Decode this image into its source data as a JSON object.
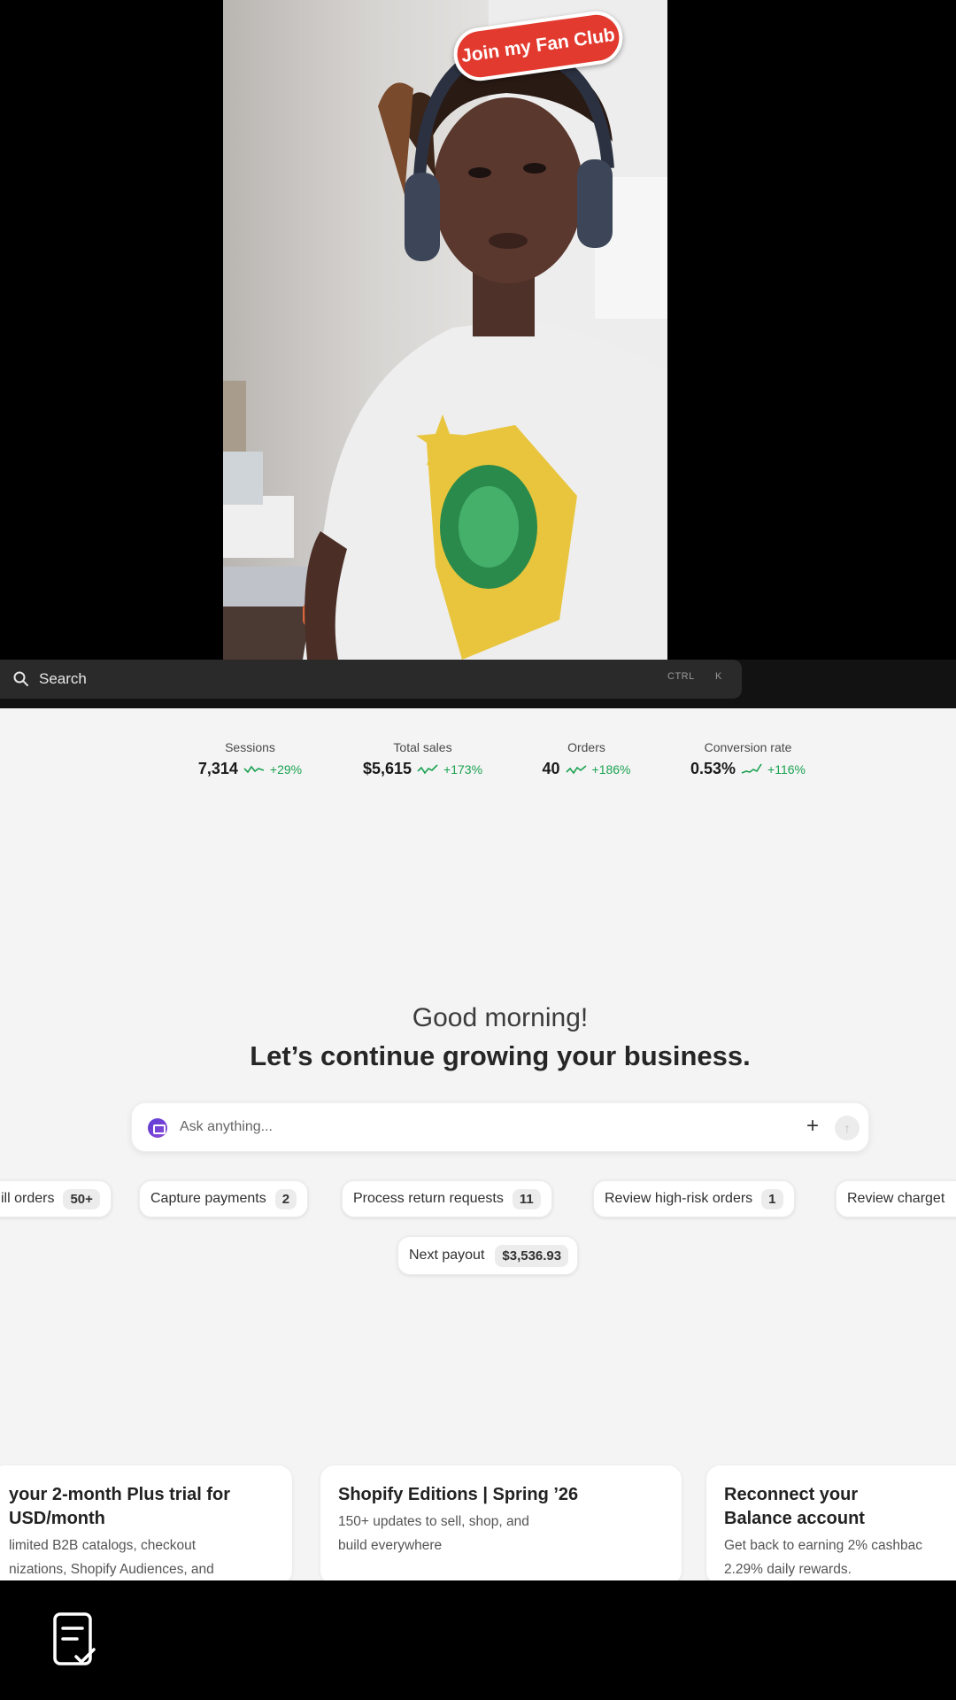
{
  "video": {
    "overlay_label": "Join my Fan Club",
    "accent": "#e33a2f"
  },
  "search": {
    "label": "Search",
    "shortcut_ctrl": "CTRL",
    "shortcut_key": "K",
    "icon": "search-icon"
  },
  "metrics": [
    {
      "label": "Sessions",
      "value": "7,314",
      "change": "+29%"
    },
    {
      "label": "Total sales",
      "value": "$5,615",
      "change": "+173%"
    },
    {
      "label": "Orders",
      "value": "40",
      "change": "+186%"
    },
    {
      "label": "Conversion rate",
      "value": "0.53%",
      "change": "+116%"
    }
  ],
  "greeting": {
    "line1": "Good morning!",
    "line2": "Let’s continue growing your business."
  },
  "ask": {
    "placeholder": "Ask anything...",
    "plus": "+",
    "send": "↑"
  },
  "chips": [
    {
      "label": "ill orders",
      "count": "50+"
    },
    {
      "label": "Capture payments",
      "count": "2"
    },
    {
      "label": "Process return requests",
      "count": "11"
    },
    {
      "label": "Review high-risk orders",
      "count": "1"
    },
    {
      "label": "Review charget",
      "count": ""
    }
  ],
  "payout": {
    "label": "Next payout",
    "amount": "$3,536.93"
  },
  "cards": [
    {
      "title1": "your 2-month Plus trial for",
      "title2": " USD/month",
      "body1": "limited B2B catalogs, checkout",
      "body2": "nizations, Shopify Audiences, and"
    },
    {
      "title1": "Shopify Editions | Spring ’26",
      "title2": "",
      "body1": "150+ updates to sell, shop, and",
      "body2": "build everywhere"
    },
    {
      "title1": "Reconnect your",
      "title2": "Balance account",
      "body1": "Get back to earning 2% cashbac",
      "body2": "2.29% daily rewards."
    }
  ],
  "colors": {
    "positive": "#1aa251",
    "page_bg": "#f4f4f4",
    "search_bg": "#2a2a2a"
  },
  "bottom": {
    "icon": "notes-check-icon"
  }
}
